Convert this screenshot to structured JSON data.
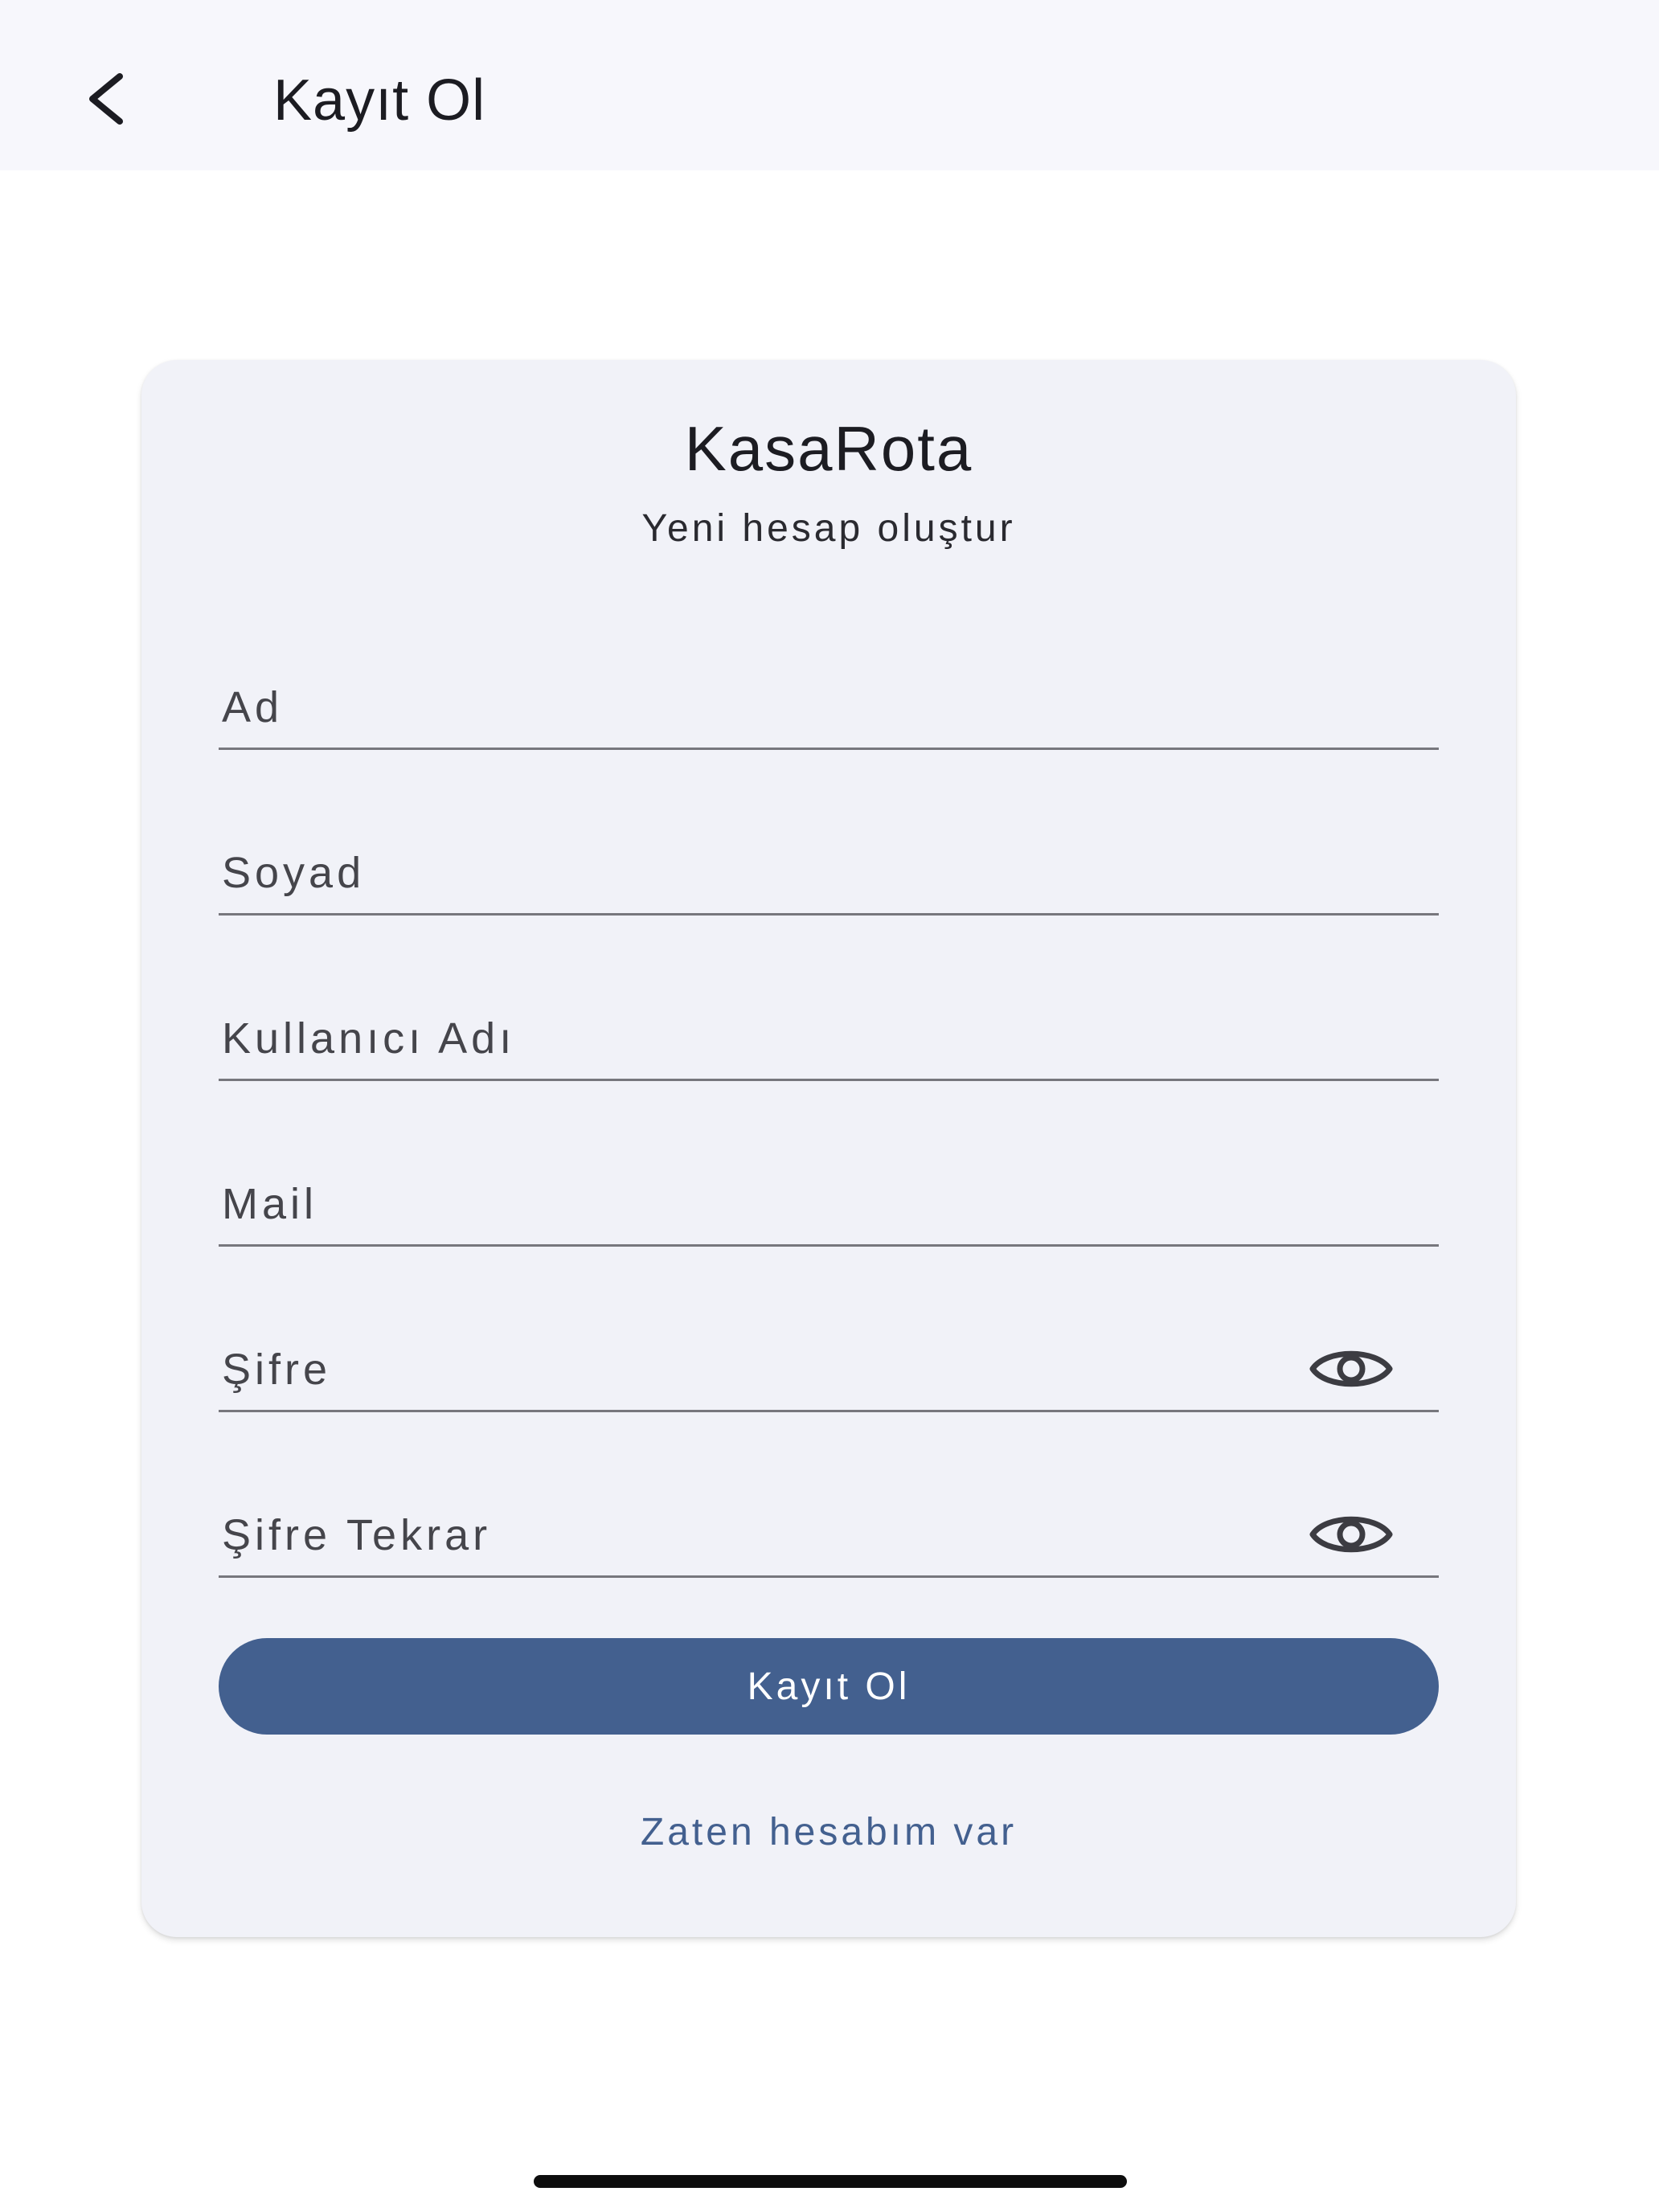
{
  "appbar": {
    "back_icon": "chevron-left-icon",
    "title": "Kayıt Ol"
  },
  "card": {
    "brand": "KasaRota",
    "subtitle": "Yeni hesap oluştur",
    "fields": [
      {
        "placeholder": "Ad",
        "value": ""
      },
      {
        "placeholder": "Soyad",
        "value": ""
      },
      {
        "placeholder": "Kullanıcı Adı",
        "value": ""
      },
      {
        "placeholder": "Mail",
        "value": ""
      },
      {
        "placeholder": "Şifre",
        "value": "",
        "trailing_icon": "eye-icon"
      },
      {
        "placeholder": "Şifre Tekrar",
        "value": "",
        "trailing_icon": "eye-icon"
      }
    ],
    "submit_label": "Kayıt Ol",
    "login_link": "Zaten hesabım var"
  },
  "colors": {
    "primary": "#43608f",
    "card_bg": "#f1f2f8",
    "appbar_bg": "#f7f7fc"
  }
}
